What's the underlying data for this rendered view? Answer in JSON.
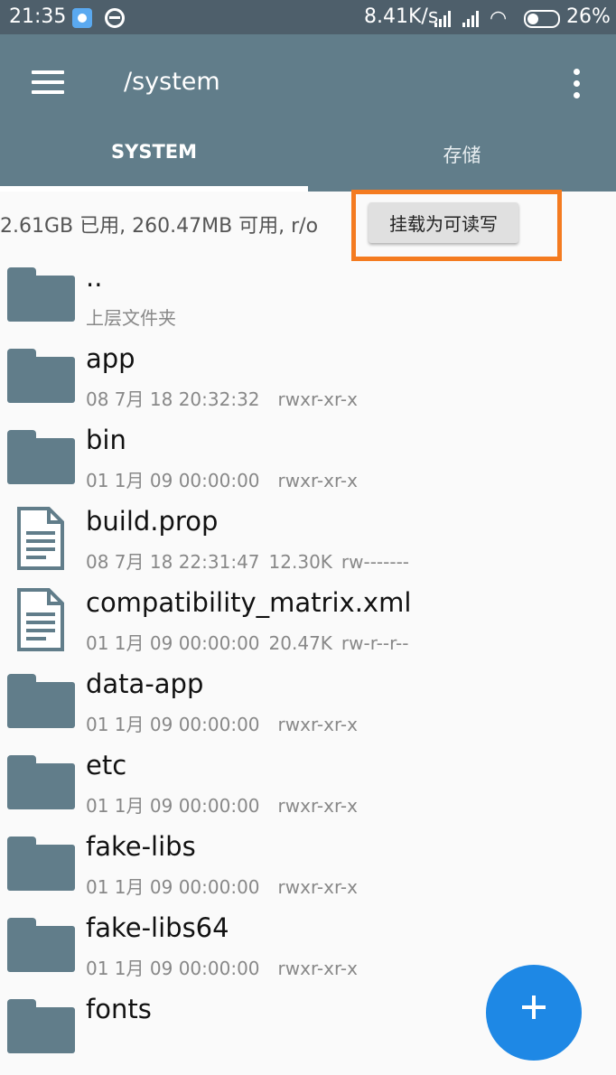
{
  "status_bar": {
    "time": "21:35",
    "speed": "8.41K/s",
    "battery": "26%"
  },
  "app_bar": {
    "title": "/system",
    "tabs": [
      "SYSTEM",
      "存储"
    ]
  },
  "info": {
    "text": "2.61GB 已用, 260.47MB 可用, r/o",
    "mount_button": "挂载为可读写"
  },
  "files": [
    {
      "name": "..",
      "date": "上层文件夹",
      "size": "",
      "perm": "",
      "type": "folder"
    },
    {
      "name": "app",
      "date": "08 7月 18 20:32:32",
      "size": "",
      "perm": "rwxr-xr-x",
      "type": "folder"
    },
    {
      "name": "bin",
      "date": "01 1月 09 00:00:00",
      "size": "",
      "perm": "rwxr-xr-x",
      "type": "folder"
    },
    {
      "name": "build.prop",
      "date": "08 7月 18 22:31:47",
      "size": "12.30K",
      "perm": "rw-------",
      "type": "file"
    },
    {
      "name": "compatibility_matrix.xml",
      "date": "01 1月 09 00:00:00",
      "size": "20.47K",
      "perm": "rw-r--r--",
      "type": "file"
    },
    {
      "name": "data-app",
      "date": "01 1月 09 00:00:00",
      "size": "",
      "perm": "rwxr-xr-x",
      "type": "folder"
    },
    {
      "name": "etc",
      "date": "01 1月 09 00:00:00",
      "size": "",
      "perm": "rwxr-xr-x",
      "type": "folder"
    },
    {
      "name": "fake-libs",
      "date": "01 1月 09 00:00:00",
      "size": "",
      "perm": "rwxr-xr-x",
      "type": "folder"
    },
    {
      "name": "fake-libs64",
      "date": "01 1月 09 00:00:00",
      "size": "",
      "perm": "rwxr-xr-x",
      "type": "folder"
    },
    {
      "name": "fonts",
      "date": "",
      "size": "",
      "perm": "",
      "type": "folder"
    }
  ],
  "colors": {
    "app_bar": "#617d8a",
    "status_bar": "#4e5f6b",
    "highlight": "#f47b20",
    "fab": "#1e88e5"
  }
}
